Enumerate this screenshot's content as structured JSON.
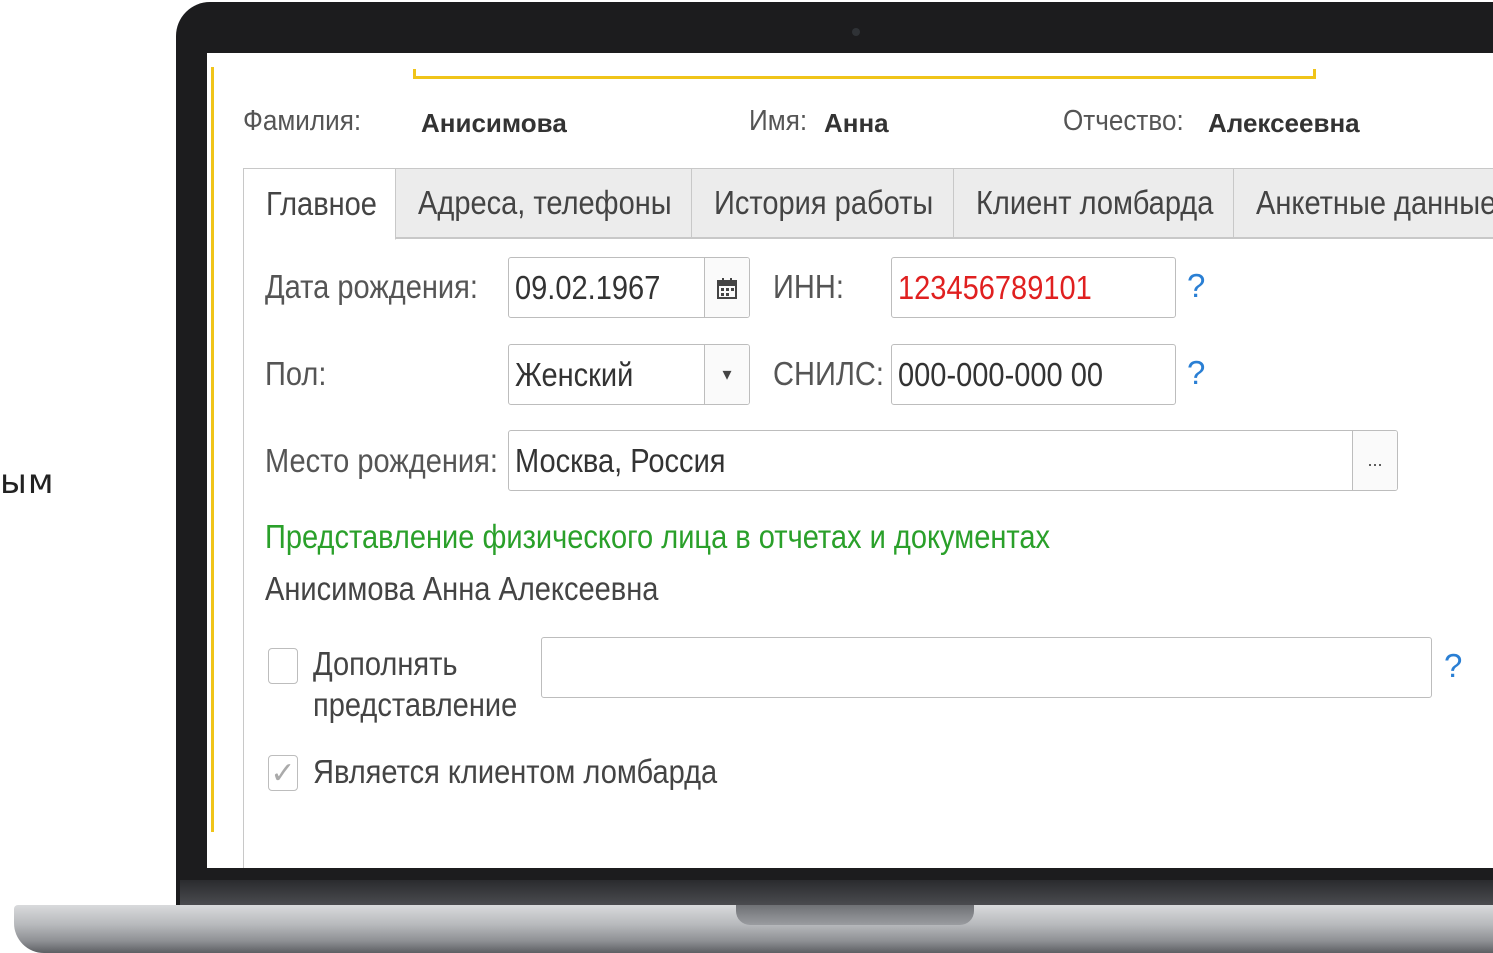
{
  "side_text": "ым",
  "header": {
    "surname_label": "Фамилия:",
    "surname_value": "Анисимова",
    "name_label": "Имя:",
    "name_value": "Анна",
    "patronymic_label": "Отчество:",
    "patronymic_value": "Алексеевна"
  },
  "tabs": [
    {
      "label": "Главное",
      "active": true
    },
    {
      "label": "Адреса, телефоны"
    },
    {
      "label": "История работы"
    },
    {
      "label": "Клиент ломбарда"
    },
    {
      "label": "Анкетные данные"
    }
  ],
  "form": {
    "birth_date_label": "Дата рождения:",
    "birth_date_value": "09.02.1967",
    "inn_label": "ИНН:",
    "inn_value": "123456789101",
    "gender_label": "Пол:",
    "gender_value": "Женский",
    "snils_label": "СНИЛС:",
    "snils_value": "000-000-000 00",
    "birth_place_label": "Место рождения:",
    "birth_place_value": "Москва, Россия",
    "select_button": "...",
    "help": "?"
  },
  "presentation": {
    "heading": "Представление физического лица в отчетах и документах",
    "value": "Анисимова Анна Алексеевна",
    "supplement_label_1": "Дополнять",
    "supplement_label_2": "представление",
    "supplement_value": "",
    "pawn_client_label": "Является клиентом ломбарда",
    "pawn_client_checked": true
  },
  "colors": {
    "accent": "#f0c419",
    "error_text": "#e02020",
    "link": "#2a7fd4",
    "section_heading": "#2aa02a"
  }
}
